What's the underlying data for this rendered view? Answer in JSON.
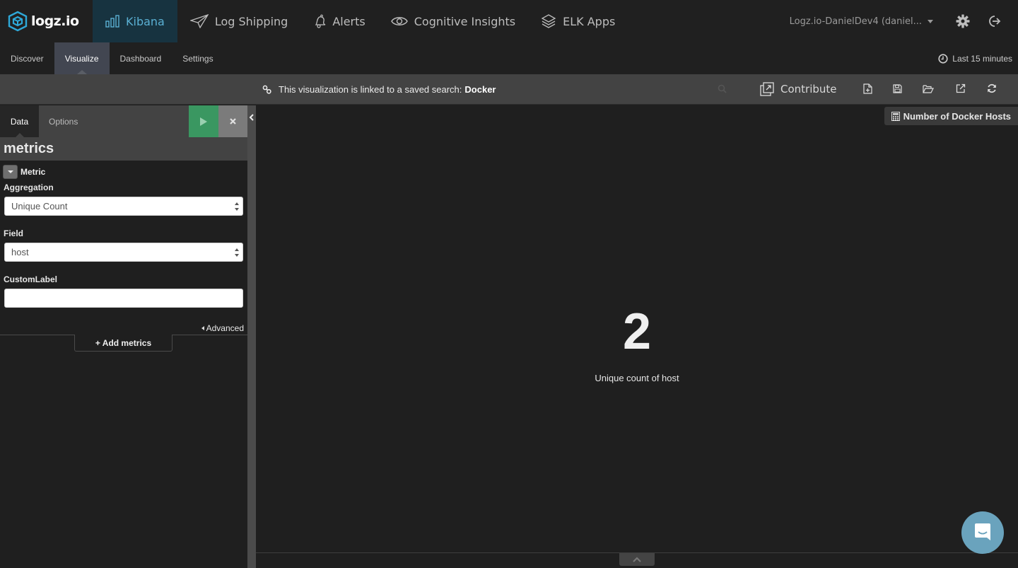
{
  "app": {
    "brand": "logz.io",
    "accent_color": "#5ab0d3",
    "run_color": "#3a9761"
  },
  "topnav": {
    "items": [
      {
        "label": "Kibana",
        "icon": "bar-chart-icon",
        "active": true
      },
      {
        "label": "Log Shipping",
        "icon": "paper-plane-icon",
        "active": false
      },
      {
        "label": "Alerts",
        "icon": "bell-icon",
        "active": false
      },
      {
        "label": "Cognitive Insights",
        "icon": "eye-icon",
        "active": false
      },
      {
        "label": "ELK Apps",
        "icon": "layers-icon",
        "active": false
      }
    ],
    "account": "Logz.io-DanielDev4 (daniel...",
    "settings_icon": "gear-icon",
    "logout_icon": "logout-icon"
  },
  "subnav": {
    "items": [
      {
        "label": "Discover",
        "active": false
      },
      {
        "label": "Visualize",
        "active": true
      },
      {
        "label": "Dashboard",
        "active": false
      },
      {
        "label": "Settings",
        "active": false
      }
    ],
    "timepicker": "Last 15 minutes"
  },
  "toolbar": {
    "linked_text": "This visualization is linked to a saved search:",
    "linked_search": "Docker",
    "contribute_label": "Contribute",
    "buttons": [
      "new-visualization",
      "save",
      "open",
      "share",
      "refresh"
    ]
  },
  "sidebar": {
    "tabs": [
      {
        "label": "Data",
        "active": true
      },
      {
        "label": "Options",
        "active": false
      }
    ],
    "section_title": "metrics",
    "agg_title": "Metric",
    "aggregation_label": "Aggregation",
    "aggregation_value": "Unique Count",
    "field_label": "Field",
    "field_value": "host",
    "custom_label_label": "CustomLabel",
    "custom_label_value": "",
    "advanced_label": "Advanced",
    "add_metrics_label": "+ Add metrics"
  },
  "visualization": {
    "title": "Number of Docker Hosts",
    "metric_value": "2",
    "metric_label": "Unique count of host"
  }
}
